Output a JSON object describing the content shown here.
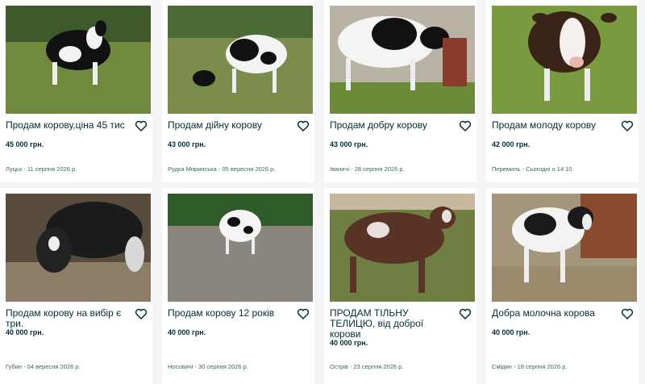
{
  "listings": [
    {
      "title": "Продам корову,ціна 45 тис",
      "price": "45 000 грн.",
      "meta": "Луцьк - 11 серпня 2026 р."
    },
    {
      "title": "Продам дійну корову",
      "price": "43 000 грн.",
      "meta": "Рудка Миринська - 05 вересня 2026 р."
    },
    {
      "title": "Продам добру корову",
      "price": "43 000 грн.",
      "meta": "Іваничі - 28 серпня 2026 р."
    },
    {
      "title": "Продам молоду корову",
      "price": "42 000 грн.",
      "meta": "Перемиль - Сьогодні о 14:10"
    },
    {
      "title": "Продам корову на вибір є три.",
      "price": "40 000 грн.",
      "meta": "Губин - 04 вересня 2026 р."
    },
    {
      "title": "Продам корову 12 років",
      "price": "40 000 грн.",
      "meta": "Носовичі - 30 серпня 2026 р."
    },
    {
      "title": "ПРОДАМ ТІЛЬНУ ТЕЛИЦЮ, від доброї корови",
      "price": "40 000 грн.",
      "meta": "Острів - 23 серпня 2026 р."
    },
    {
      "title": "Добра молочна корова",
      "price": "40 000 грн.",
      "meta": "Смідин - 18 серпня 2026 р."
    }
  ],
  "icons": {
    "favorite": "heart-outline-icon"
  },
  "colors": {
    "text": "#002f34",
    "meta": "#406367",
    "background": "#f2f4f5",
    "card": "#ffffff"
  }
}
